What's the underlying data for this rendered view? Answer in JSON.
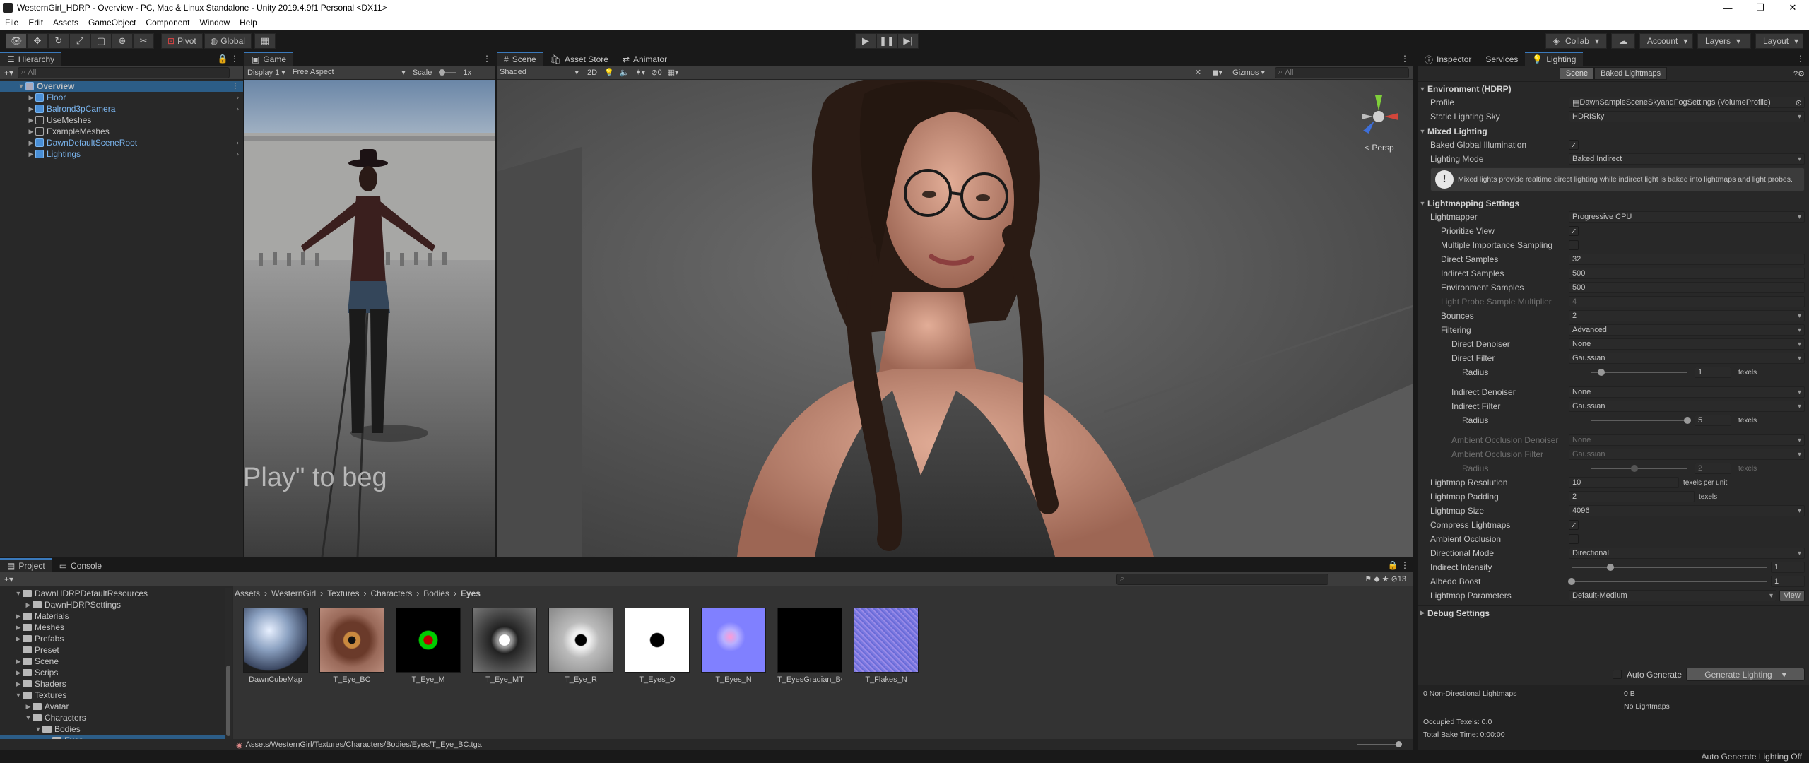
{
  "window": {
    "title": "WesternGirl_HDRP - Overview - PC, Mac & Linux Standalone - Unity 2019.4.9f1 Personal <DX11>",
    "controls": [
      "—",
      "❐",
      "✕"
    ]
  },
  "menu": [
    "File",
    "Edit",
    "Assets",
    "GameObject",
    "Component",
    "Window",
    "Help"
  ],
  "toolbar": {
    "pivot_label": "Pivot",
    "global_label": "Global",
    "collab_label": "Collab",
    "account_label": "Account",
    "layers_label": "Layers",
    "layout_label": "Layout"
  },
  "hierarchy": {
    "tab_label": "Hierarchy",
    "search_placeholder": "All",
    "items": [
      {
        "label": "Overview",
        "selected": true
      },
      {
        "label": "Floor"
      },
      {
        "label": "Balrond3pCamera"
      },
      {
        "label": "UseMeshes"
      },
      {
        "label": "ExampleMeshes"
      },
      {
        "label": "DawnDefaultSceneRoot"
      },
      {
        "label": "Lightings"
      }
    ]
  },
  "game": {
    "tab_label": "Game",
    "display_label": "Display 1",
    "aspect_label": "Free Aspect",
    "scale_label": "Scale",
    "scale_value": "1x",
    "overlay_text": "Play\" to beg"
  },
  "scene": {
    "tabs": [
      "Scene",
      "Asset Store",
      "Animator"
    ],
    "shading_mode": "Shaded",
    "mode_2d": "2D",
    "gizmos_label": "Gizmos",
    "search_placeholder": "All",
    "persp_label": "< Persp",
    "hidden_count": "0"
  },
  "inspector": {
    "tabs": [
      "Inspector",
      "Services",
      "Lighting"
    ],
    "subtabs": [
      "Scene",
      "Baked Lightmaps"
    ],
    "environment": {
      "header": "Environment (HDRP)",
      "profile_label": "Profile",
      "profile_value": "DawnSampleSceneSkyandFogSettings (VolumeProfile)",
      "sky_label": "Static Lighting Sky",
      "sky_value": "HDRISky"
    },
    "mixed": {
      "header": "Mixed Lighting",
      "baked_gi_label": "Baked Global Illumination",
      "mode_label": "Lighting Mode",
      "mode_value": "Baked Indirect",
      "info_text": "Mixed lights provide realtime direct lighting while indirect light is baked into lightmaps and light probes."
    },
    "lightmapping": {
      "header": "Lightmapping Settings",
      "rows": [
        {
          "label": "Lightmapper",
          "value": "Progressive CPU",
          "type": "dd"
        },
        {
          "label": "Prioritize View",
          "value": "✓",
          "type": "check",
          "indent": 1
        },
        {
          "label": "Multiple Importance Sampling",
          "value": "",
          "type": "check",
          "indent": 1
        },
        {
          "label": "Direct Samples",
          "value": "32",
          "type": "field",
          "indent": 1
        },
        {
          "label": "Indirect Samples",
          "value": "500",
          "type": "field",
          "indent": 1
        },
        {
          "label": "Environment Samples",
          "value": "500",
          "type": "field",
          "indent": 1
        },
        {
          "label": "Light Probe Sample Multiplier",
          "value": "4",
          "type": "field",
          "indent": 1,
          "dim": true
        },
        {
          "label": "Bounces",
          "value": "2",
          "type": "dd",
          "indent": 1
        },
        {
          "label": "Filtering",
          "value": "Advanced",
          "type": "dd",
          "indent": 1
        },
        {
          "label": "Direct Denoiser",
          "value": "None",
          "type": "dd",
          "indent": 2
        },
        {
          "label": "Direct Filter",
          "value": "Gaussian",
          "type": "dd",
          "indent": 2
        },
        {
          "label": "Radius",
          "value": "1",
          "type": "slider",
          "indent": 3,
          "fraction": 0.1,
          "unit": "texels"
        },
        {
          "label": "",
          "value": "",
          "type": "spacer"
        },
        {
          "label": "Indirect Denoiser",
          "value": "None",
          "type": "dd",
          "indent": 2
        },
        {
          "label": "Indirect Filter",
          "value": "Gaussian",
          "type": "dd",
          "indent": 2
        },
        {
          "label": "Radius",
          "value": "5",
          "type": "slider",
          "indent": 3,
          "fraction": 1.0,
          "unit": "texels"
        },
        {
          "label": "",
          "value": "",
          "type": "spacer"
        },
        {
          "label": "Ambient Occlusion Denoiser",
          "value": "None",
          "type": "dd",
          "indent": 2,
          "dim": true
        },
        {
          "label": "Ambient Occlusion Filter",
          "value": "Gaussian",
          "type": "dd",
          "indent": 2,
          "dim": true
        },
        {
          "label": "Radius",
          "value": "2",
          "type": "slider",
          "indent": 3,
          "fraction": 0.45,
          "unit": "texels",
          "dim": true
        },
        {
          "label": "Lightmap Resolution",
          "value": "10",
          "type": "unitfield",
          "unit": "texels per unit"
        },
        {
          "label": "Lightmap Padding",
          "value": "2",
          "type": "unitfield",
          "unit": "texels"
        },
        {
          "label": "Lightmap Size",
          "value": "4096",
          "type": "dd"
        },
        {
          "label": "Compress Lightmaps",
          "value": "✓",
          "type": "check"
        },
        {
          "label": "Ambient Occlusion",
          "value": "",
          "type": "check"
        },
        {
          "label": "Directional Mode",
          "value": "Directional",
          "type": "dd"
        },
        {
          "label": "Indirect Intensity",
          "value": "1",
          "type": "slider2",
          "fraction": 0.2
        },
        {
          "label": "Albedo Boost",
          "value": "1",
          "type": "slider2",
          "fraction": 0.0
        },
        {
          "label": "Lightmap Parameters",
          "value": "Default-Medium",
          "type": "ddview",
          "button": "View"
        }
      ]
    },
    "debug": {
      "header": "Debug Settings"
    },
    "auto_generate_label": "Auto Generate",
    "generate_button": "Generate Lighting",
    "stats": {
      "non_directional": "0 Non-Directional Lightmaps",
      "size": "0 B",
      "no_lightmaps": "No Lightmaps",
      "occupied": "Occupied Texels: 0.0",
      "bake_time": "Total Bake Time: 0:00:00"
    }
  },
  "project": {
    "tabs": [
      "Project",
      "Console"
    ],
    "tree": [
      {
        "label": "DawnHDRPDefaultResources",
        "indent": 1,
        "open": true
      },
      {
        "label": "DawnHDRPSettings",
        "indent": 2
      },
      {
        "label": "Materials",
        "indent": 1
      },
      {
        "label": "Meshes",
        "indent": 1
      },
      {
        "label": "Prefabs",
        "indent": 1
      },
      {
        "label": "Preset",
        "indent": 1,
        "leaf": true
      },
      {
        "label": "Scene",
        "indent": 1
      },
      {
        "label": "Scrips",
        "indent": 1
      },
      {
        "label": "Shaders",
        "indent": 1
      },
      {
        "label": "Textures",
        "indent": 1,
        "open": true
      },
      {
        "label": "Avatar",
        "indent": 2
      },
      {
        "label": "Characters",
        "indent": 2,
        "open": true
      },
      {
        "label": "Bodies",
        "indent": 3,
        "open": true
      },
      {
        "label": "Eyes",
        "indent": 4,
        "leaf": true,
        "selected": true
      }
    ],
    "breadcrumb": [
      "Assets",
      "WesternGirl",
      "Textures",
      "Characters",
      "Bodies",
      "Eyes"
    ],
    "assets": [
      {
        "name": "DawnCubeMap",
        "kind": "sphere"
      },
      {
        "name": "T_Eye_BC",
        "kind": "iris"
      },
      {
        "name": "T_Eye_M",
        "kind": "mask"
      },
      {
        "name": "T_Eye_MT",
        "kind": "mt"
      },
      {
        "name": "T_Eye_R",
        "kind": "rough"
      },
      {
        "name": "T_Eyes_D",
        "kind": "dot"
      },
      {
        "name": "T_Eyes_N",
        "kind": "normal"
      },
      {
        "name": "T_EyesGradian_BC",
        "kind": "black"
      },
      {
        "name": "T_Flakes_N",
        "kind": "flakes"
      }
    ],
    "selected_path": "Assets/WesternGirl/Textures/Characters/Bodies/Eyes/T_Eye_BC.tga",
    "hidden_count": "13"
  },
  "status": {
    "text": "Auto Generate Lighting Off"
  }
}
